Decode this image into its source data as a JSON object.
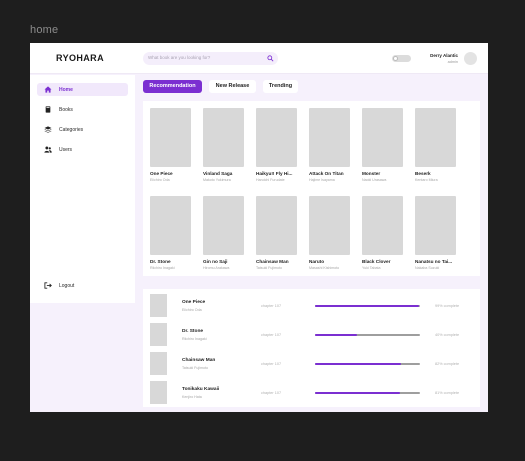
{
  "frame_label": "home",
  "header": {
    "logo": "RYOHARA",
    "search_placeholder": "What book are you looking for?",
    "user_name": "Derry Alantic",
    "user_role": "admin",
    "theme_toggle_on": false
  },
  "sidebar": {
    "items": [
      {
        "label": "Home",
        "icon": "home-icon",
        "active": true
      },
      {
        "label": "Books",
        "icon": "book-icon",
        "active": false
      },
      {
        "label": "Categories",
        "icon": "layers-icon",
        "active": false
      },
      {
        "label": "Users",
        "icon": "users-icon",
        "active": false
      }
    ],
    "logout_label": "Logout"
  },
  "tabs": [
    {
      "label": "Recommendation",
      "active": true
    },
    {
      "label": "New Release",
      "active": false
    },
    {
      "label": "Trending",
      "active": false
    }
  ],
  "books": [
    {
      "title": "One Piece",
      "author": "Eiichiro Oda"
    },
    {
      "title": "Vinland Saga",
      "author": "Makoto Yukimura"
    },
    {
      "title": "Haikyu!! Fly Hi...",
      "author": "Haruichi Furudate"
    },
    {
      "title": "Attack On Titan",
      "author": "Hajime Isayama"
    },
    {
      "title": "Monster",
      "author": "Naoki Urasawa"
    },
    {
      "title": "Beserk",
      "author": "Kentaro Miura"
    },
    {
      "title": "Dr. Stone",
      "author": "Riichiro Inagaki"
    },
    {
      "title": "Gin no Saji",
      "author": "Hiromu Arakawa"
    },
    {
      "title": "Chainsaw Man",
      "author": "Tatsuki Fujimoto"
    },
    {
      "title": "Naruto",
      "author": "Masashi Kishimoto"
    },
    {
      "title": "Black Clover",
      "author": "Yuki Tabata"
    },
    {
      "title": "Nanatsu no Tai...",
      "author": "Nakaba Suzuki"
    }
  ],
  "reading": [
    {
      "title": "One Piece",
      "author": "Eiichiro Oda",
      "chapter": "chapter 107",
      "progress": 0.99,
      "progress_label": "99% complete"
    },
    {
      "title": "Dr. Stone",
      "author": "Riichiro Inagaki",
      "chapter": "chapter 107",
      "progress": 0.4,
      "progress_label": "40% complete"
    },
    {
      "title": "Chainsaw Man",
      "author": "Tatsuki Fujimoto",
      "chapter": "chapter 107",
      "progress": 0.82,
      "progress_label": "82% complete"
    },
    {
      "title": "Tonikaku Kawaii",
      "author": "Kenjiro Hata",
      "chapter": "chapter 107",
      "progress": 0.81,
      "progress_label": "81% complete"
    }
  ],
  "colors": {
    "accent": "#7b2fd1",
    "panel": "#ffffff",
    "background": "#f6f1fc",
    "placeholder": "#d8d8d8"
  }
}
